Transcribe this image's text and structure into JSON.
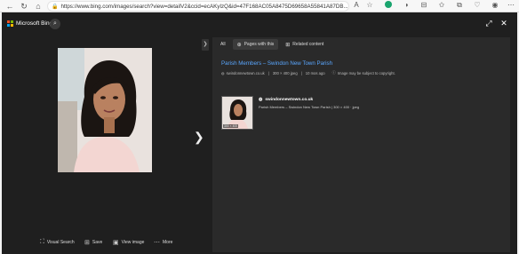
{
  "browser": {
    "url": "https://www.bing.com/images/search?view=detailV2&ccid=ecAKyIzQ&id=47F168AC05A8475D69658A55841A87DB..."
  },
  "bing": {
    "logo_text": "Microsoft Bing"
  },
  "actions": [
    {
      "name": "visual-search",
      "label": "Visual Search",
      "icon": "visual-search-icon"
    },
    {
      "name": "save",
      "label": "Save",
      "icon": "save-icon"
    },
    {
      "name": "view-image",
      "label": "View image",
      "icon": "view-image-icon"
    },
    {
      "name": "more",
      "label": "More",
      "icon": "more-icon"
    }
  ],
  "tabs": {
    "all": "All",
    "pages": "Pages with this",
    "related": "Related content"
  },
  "detail": {
    "title": "Parish Members – Swindon New Town Parish",
    "domain": "swindonnewtown.co.uk",
    "size": "300 × 400 jpeg",
    "age": "10 mos ago",
    "warning": "Image may be subject to copyright."
  },
  "result": {
    "domain": "swindonnewtown.co.uk",
    "description": "Parish Members – Swindon New Town Parish | 300 × 400 · jpeg",
    "thumb_dim": "300 × 400"
  }
}
